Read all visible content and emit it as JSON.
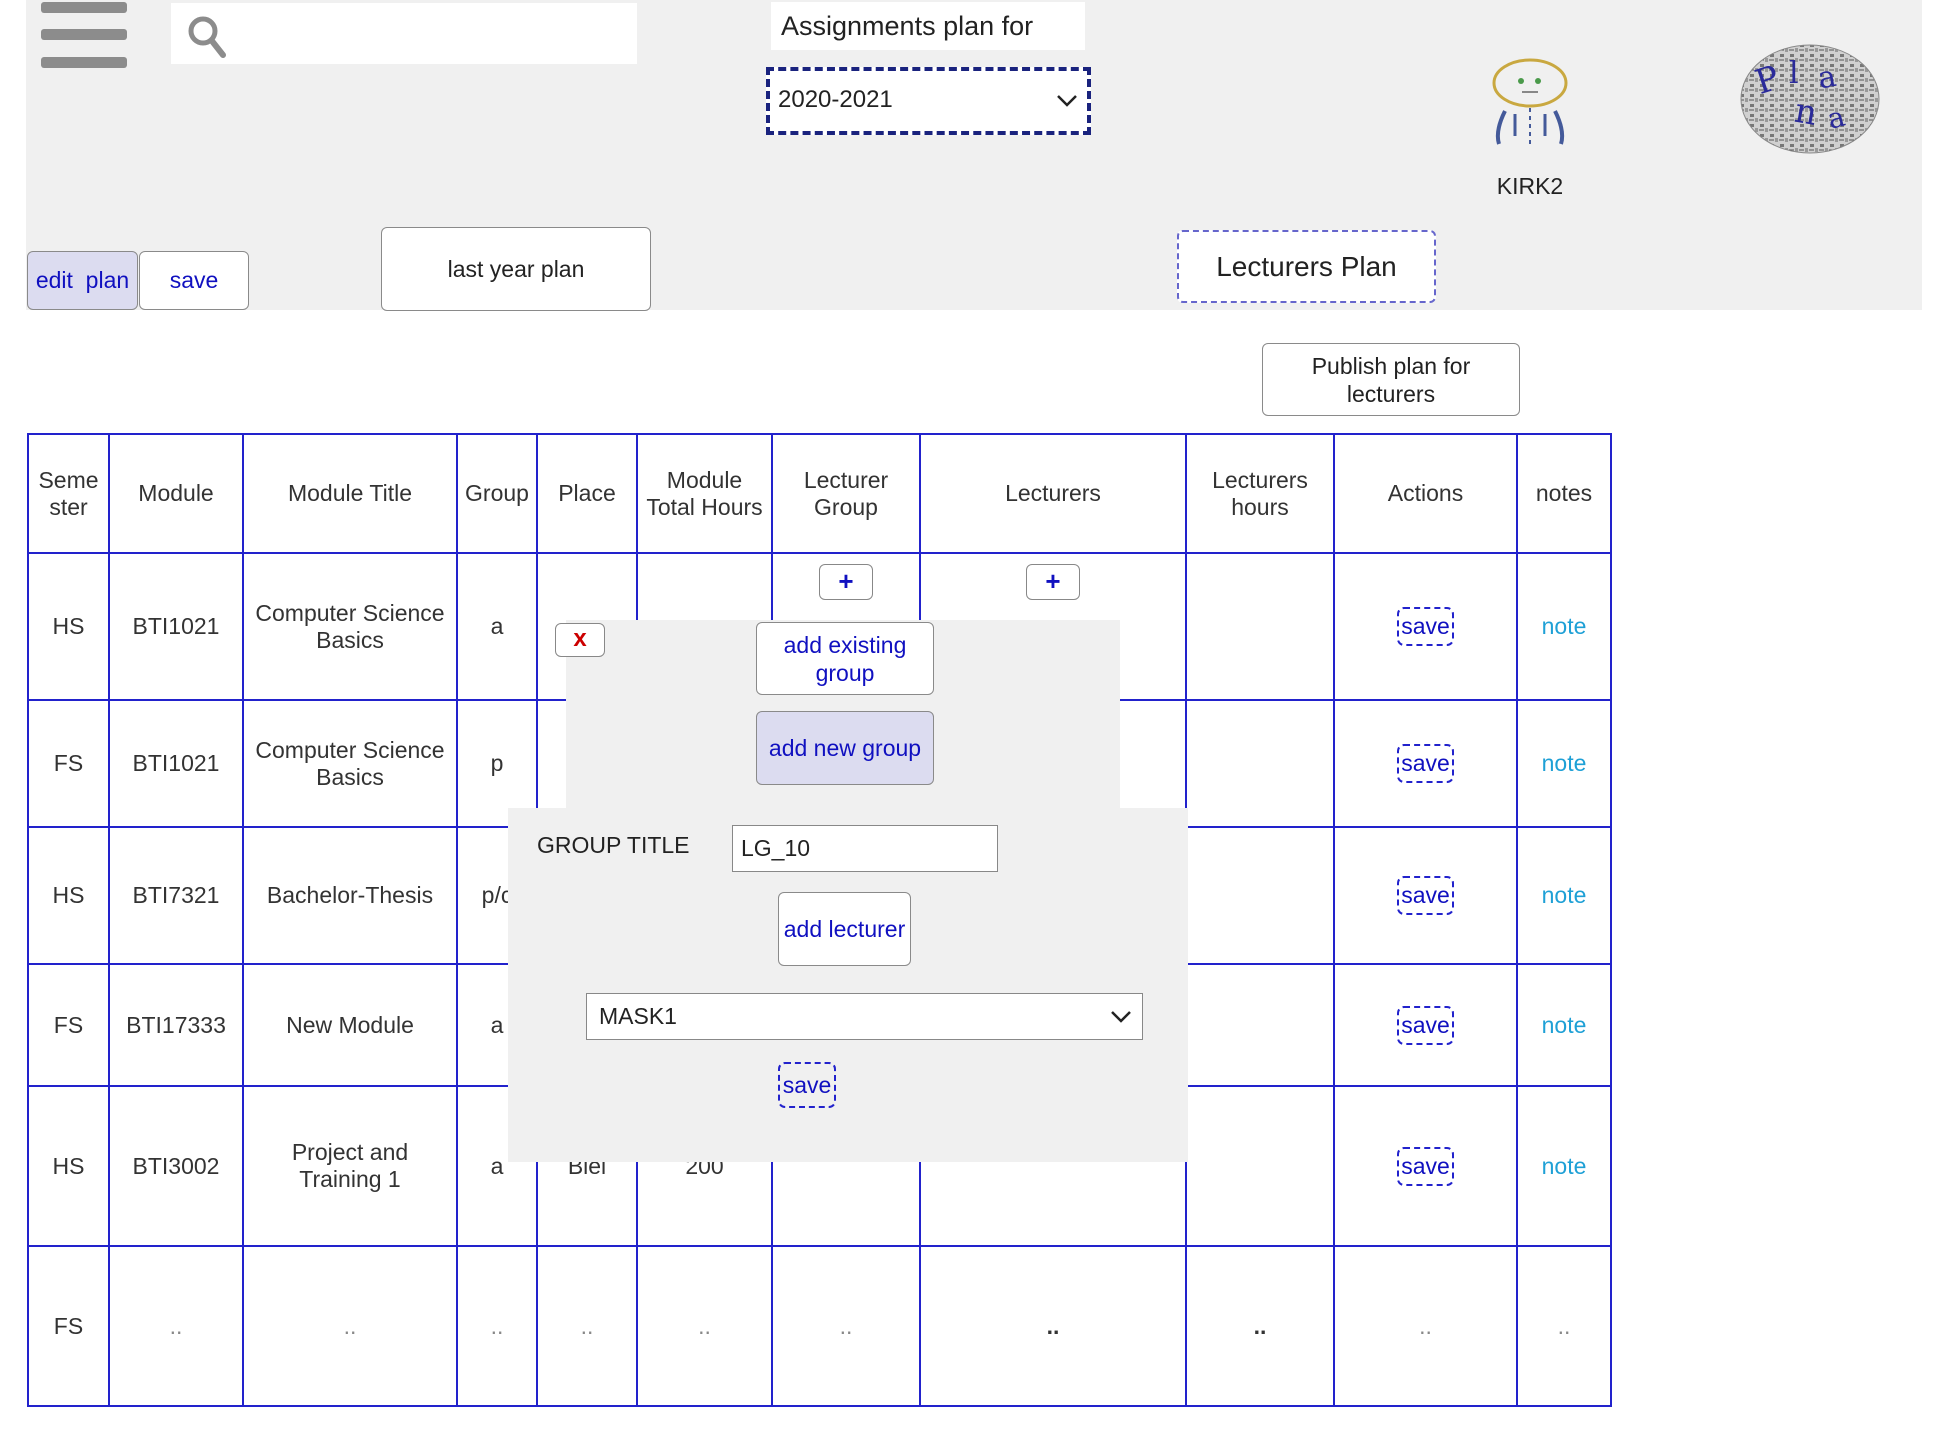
{
  "header": {
    "assignments_title": "Assignments plan for",
    "year_selected": "2020-2021",
    "username": "KIRK2",
    "edit_plan": "edit  plan",
    "save": "save",
    "last_year_plan": "last year plan",
    "lecturers_plan": "Lecturers Plan",
    "publish": "Publish plan for lecturers"
  },
  "table": {
    "headers": [
      "Seme ster",
      "Module",
      "Module Title",
      "Group",
      "Place",
      "Module Total Hours",
      "Lecturer Group",
      "Lecturers",
      "Lecturers hours",
      "Actions",
      "notes"
    ],
    "rows": [
      {
        "semester": "HS",
        "module": "BTI1021",
        "title": "Computer Science Basics",
        "group": "a",
        "place": "",
        "hours": "",
        "save": "save",
        "note": "note"
      },
      {
        "semester": "FS",
        "module": "BTI1021",
        "title": "Computer Science Basics",
        "group": "p",
        "place": "",
        "hours": "",
        "save": "save",
        "note": "note"
      },
      {
        "semester": "HS",
        "module": "BTI7321",
        "title": "Bachelor-Thesis",
        "group": "p/c",
        "place": "",
        "hours": "",
        "save": "save",
        "note": "note"
      },
      {
        "semester": "FS",
        "module": "BTI17333",
        "title": "New Module",
        "group": "a",
        "place": "",
        "hours": "",
        "save": "save",
        "note": "note"
      },
      {
        "semester": "HS",
        "module": "BTI3002",
        "title": "Project and Training 1",
        "group": "a",
        "place": "Biel",
        "hours": "200",
        "save": "save",
        "note": "note"
      }
    ],
    "last_row": {
      "semester": "FS",
      "placeholder": "..",
      "bold_placeholder": ".."
    },
    "plus_symbol": "+"
  },
  "popup": {
    "close_symbol": "x",
    "add_existing_group": "add existing group",
    "add_new_group": "add new group",
    "group_title_label": "GROUP TITLE",
    "group_title_value": "LG_10",
    "add_lecturer": "add lecturer",
    "lecturer_selected": "MASK1",
    "save": "save"
  },
  "colors": {
    "accent_blue": "#1010c0",
    "table_border": "#2222cc",
    "note_link": "#1ea0d6",
    "header_bg": "#f0f0f0",
    "close_red": "#cc0000"
  },
  "icons": [
    "menu-icon",
    "search-icon",
    "chevron-down-icon",
    "avatar-icon",
    "logo-icon",
    "close-icon",
    "plus-icon"
  ]
}
